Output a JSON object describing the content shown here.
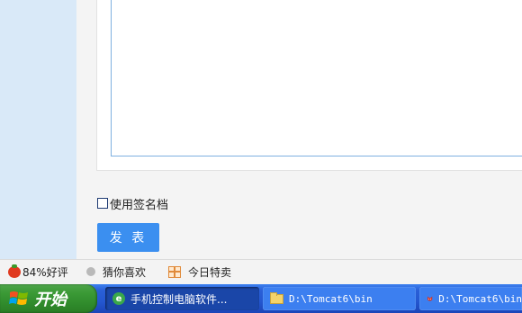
{
  "form": {
    "signature_label": "使用签名档",
    "submit_label": "发 表"
  },
  "status_bar": {
    "rating": "84%好评",
    "guess": "猜你喜欢",
    "deals": "今日特卖"
  },
  "taskbar": {
    "start_label": "开始",
    "tasks": [
      {
        "label": "手机控制电脑软件...",
        "icon": "browser-icon",
        "active": true
      },
      {
        "label": "D:\\Tomcat6\\bin",
        "icon": "folder-icon",
        "active": false
      },
      {
        "label": "D:\\Tomcat6\\bin",
        "icon": "tomcat-icon",
        "active": false
      }
    ]
  },
  "colors": {
    "submit_button": "#3b8ff0",
    "left_panel": "#d9e9f8",
    "taskbar": "#2457d0",
    "start_button": "#3b9a36"
  }
}
